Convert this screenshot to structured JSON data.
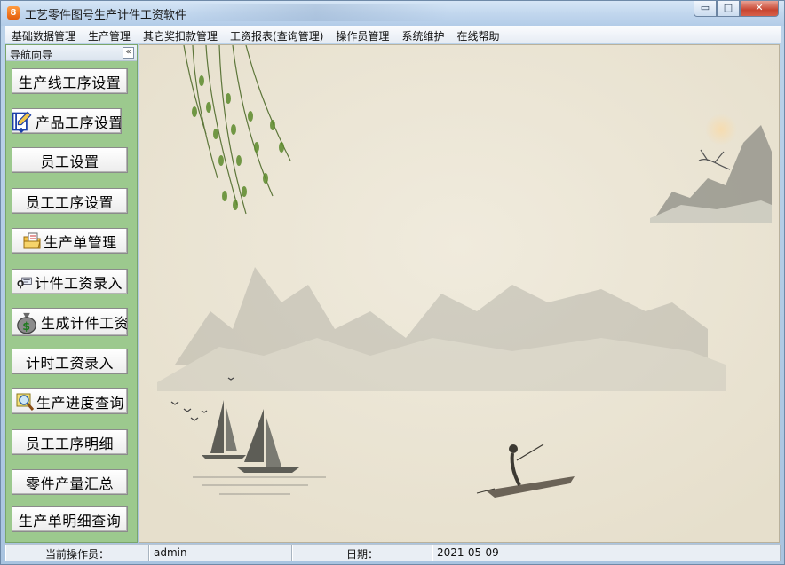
{
  "window": {
    "title": "工艺零件图号生产计件工资软件",
    "app_icon_glyph": "8",
    "controls": {
      "minimize": "▭",
      "maximize": "□",
      "close": "✕"
    }
  },
  "menu": [
    "基础数据管理",
    "生产管理",
    "其它奖扣款管理",
    "工资报表(查询管理)",
    "操作员管理",
    "系统维护",
    "在线帮助"
  ],
  "sidebar": {
    "title": "导航向导",
    "collapse_glyph": "«",
    "items": [
      {
        "label": "生产线工序设置",
        "icon": null
      },
      {
        "label": "产品工序设置",
        "icon": "notebook-edit-icon"
      },
      {
        "label": "员工设置",
        "icon": null
      },
      {
        "label": "员工工序设置",
        "icon": null
      },
      {
        "label": "生产单管理",
        "icon": "folder-document-icon"
      },
      {
        "label": "计件工资录入",
        "icon": "key-card-icon"
      },
      {
        "label": "生成计件工资",
        "icon": "money-bag-icon"
      },
      {
        "label": "计时工资录入",
        "icon": null
      },
      {
        "label": "生产进度查询",
        "icon": "magnifier-icon"
      },
      {
        "label": "员工工序明细",
        "icon": null
      },
      {
        "label": "零件产量汇总",
        "icon": null
      },
      {
        "label": "生产单明细查询",
        "icon": null
      }
    ]
  },
  "status": {
    "operator_label": "当前操作员：",
    "operator_value": "admin",
    "date_label": "日期：",
    "date_value": "2021-05-09"
  },
  "colors": {
    "sidebar_bg": "#9cc98e",
    "paper_bg": "#ece6d6",
    "ink": "#5a5a52"
  }
}
